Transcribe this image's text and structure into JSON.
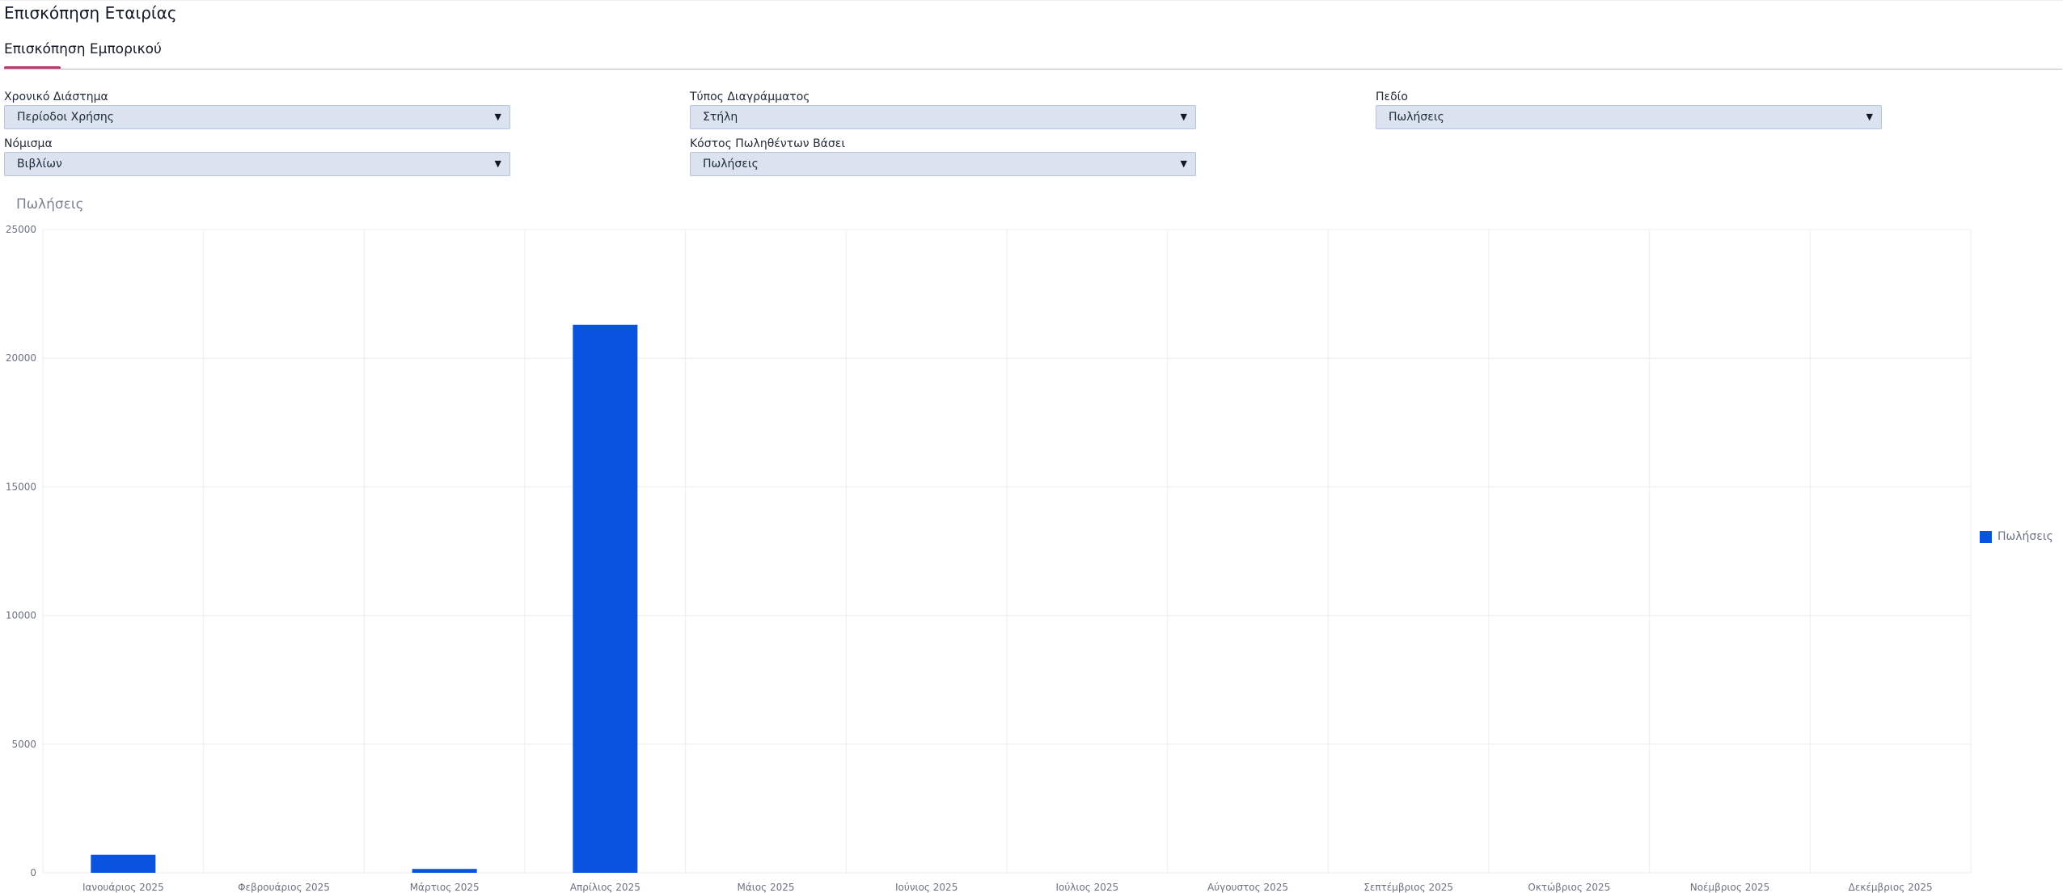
{
  "header": {
    "title": "Επισκόπηση Εταιρίας",
    "tab_label": "Επισκόπηση Εμπορικού"
  },
  "filters": {
    "time_range": {
      "label": "Χρονικό Διάστημα",
      "value": "Περίοδοι Χρήσης"
    },
    "chart_type": {
      "label": "Τύπος Διαγράμματος",
      "value": "Στήλη"
    },
    "field": {
      "label": "Πεδίο",
      "value": "Πωλήσεις"
    },
    "currency": {
      "label": "Νόμισμα",
      "value": "Βιβλίων"
    },
    "cost_basis": {
      "label": "Κόστος Πωληθέντων Βάσει",
      "value": "Πωλήσεις"
    }
  },
  "colors": {
    "bar": "#0a52e0",
    "accent": "#b83b6b",
    "grid": "#eceef1"
  },
  "chart_data": {
    "type": "bar",
    "title": "Πωλήσεις",
    "categories": [
      "Ιανουάριος 2025",
      "Φεβρουάριος 2025",
      "Μάρτιος 2025",
      "Απρίλιος 2025",
      "Μάιος 2025",
      "Ιούνιος 2025",
      "Ιούλιος 2025",
      "Αύγουστος 2025",
      "Σεπτέμβριος 2025",
      "Οκτώβριος 2025",
      "Νοέμβριος 2025",
      "Δεκέμβριος 2025"
    ],
    "series": [
      {
        "name": "Πωλήσεις",
        "values": [
          700,
          0,
          150,
          21300,
          0,
          0,
          0,
          0,
          0,
          0,
          0,
          0
        ]
      }
    ],
    "ylim": [
      0,
      25000
    ],
    "yticks": [
      0,
      5000,
      10000,
      15000,
      20000,
      25000
    ],
    "grid": true,
    "legend_position": "right"
  }
}
